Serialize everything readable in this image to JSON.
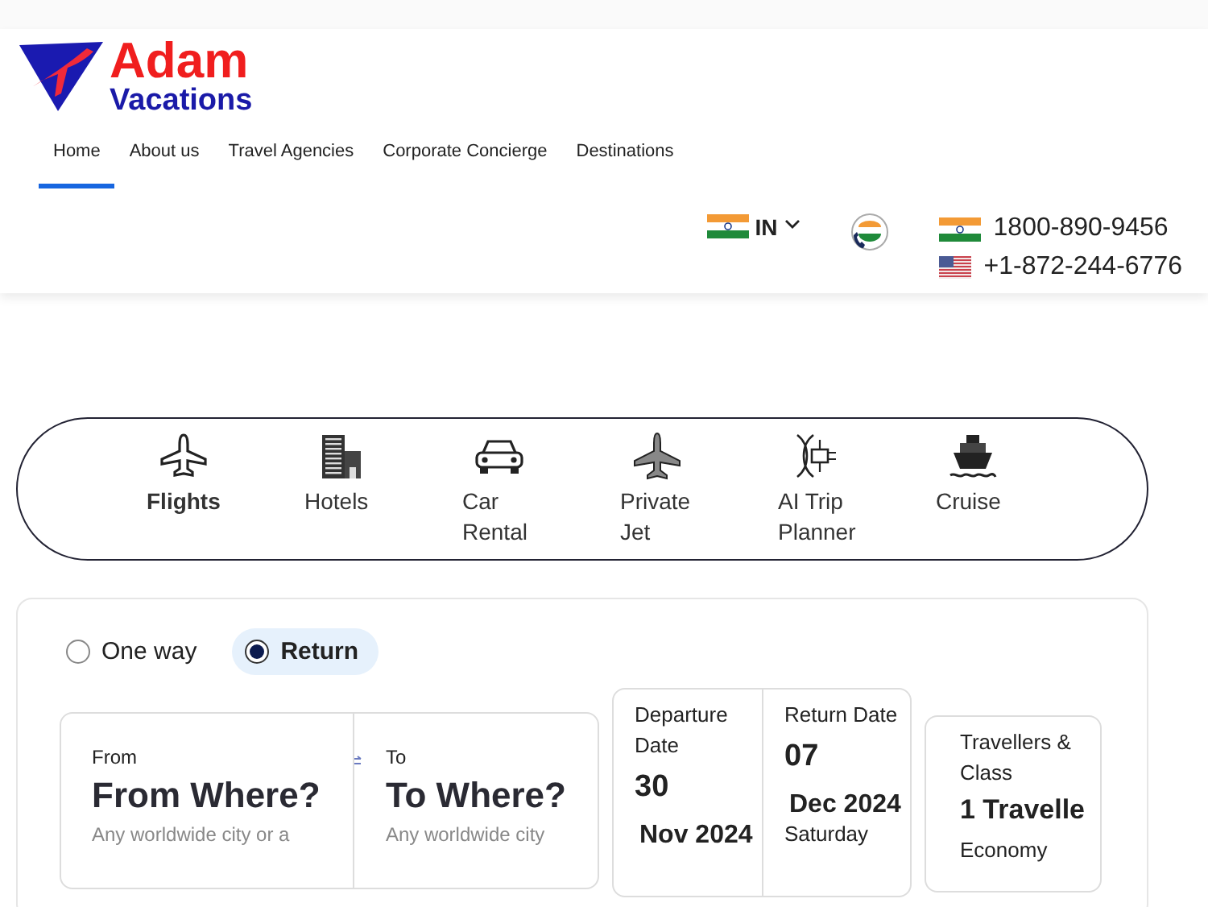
{
  "logo": {
    "line_1": "Adam",
    "line_2": "Vacations"
  },
  "nav": [
    {
      "label": "Home",
      "selected": true
    },
    {
      "label": "About us",
      "selected": false
    },
    {
      "label": "Travel Agencies",
      "selected": false
    },
    {
      "label": "Corporate Concierge",
      "selected": false
    },
    {
      "label": "Destinations",
      "selected": false
    }
  ],
  "country": {
    "code": "IN"
  },
  "phones": [
    {
      "kind": "india",
      "number": "1800-890-9456"
    },
    {
      "kind": "usa",
      "number": "+1-872-244-6776"
    }
  ],
  "services": [
    {
      "kind": "flight",
      "label": "Flights",
      "selected": true
    },
    {
      "kind": "hotel",
      "label": "Hotels",
      "selected": false
    },
    {
      "kind": "car",
      "label": "Car Rental",
      "selected": false
    },
    {
      "kind": "jet",
      "label": "Private Jet",
      "selected": false
    },
    {
      "kind": "ai",
      "label": "AI Trip Planner",
      "selected": false
    },
    {
      "kind": "cruise",
      "label": "Cruise",
      "selected": false
    }
  ],
  "trip_types": [
    {
      "label": "One way",
      "selected": false
    },
    {
      "label": "Return",
      "selected": true
    }
  ],
  "from": {
    "label": "From",
    "value": "From Where?",
    "hint": "Any worldwide city or a"
  },
  "to": {
    "label": "To",
    "value": "To Where?",
    "hint": "Any worldwide city"
  },
  "departure": {
    "label": "Departure Date",
    "day": "30",
    "month": "Nov 2024"
  },
  "return": {
    "label": "Return Date",
    "day": "07",
    "month": "Dec 2024",
    "weekday": "Saturday"
  },
  "travellers": {
    "label": "Travellers & Class",
    "value": "1 Travelle",
    "class": "Economy"
  }
}
